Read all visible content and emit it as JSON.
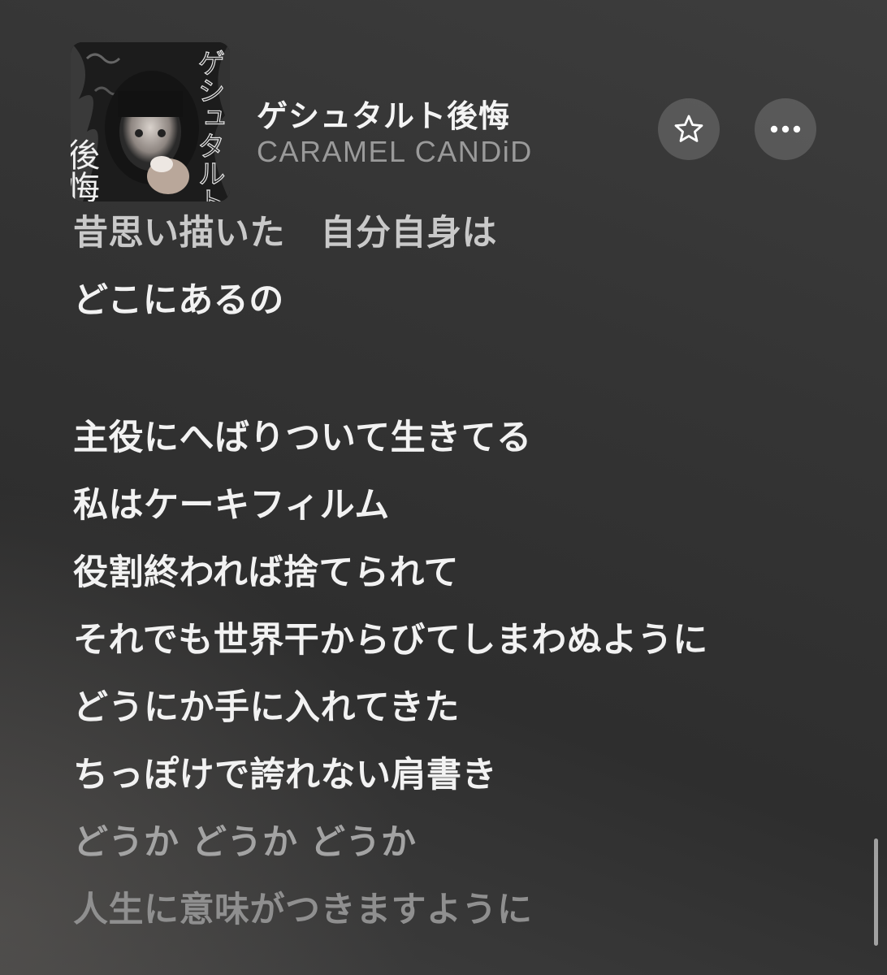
{
  "now_playing": {
    "title": "ゲシュタルト後悔",
    "artist": "CARAMEL CANDiD",
    "artwork": {
      "icon": "album-artwork-icon",
      "art_text_left": "後悔",
      "art_text_right": "ゲシュタルト"
    }
  },
  "controls": {
    "favorite_icon": "star-outline-icon",
    "more_icon": "ellipsis-icon"
  },
  "lyrics": {
    "lines": [
      "昔思い描いた　自分自身は",
      "どこにあるの",
      "",
      "主役にへばりついて生きてる",
      "私はケーキフィルム",
      "役割終われば捨てられて",
      "それでも世界干からびてしまわぬように",
      "どうにか手に入れてきた",
      "ちっぽけで誇れない肩書き",
      "どうか どうか どうか",
      "人生に意味がつきますように"
    ]
  },
  "colors": {
    "text_primary": "#f2f2f2",
    "text_secondary": "#9a9a9a",
    "button_bg": "rgba(255,255,255,0.16)",
    "background": "#353535"
  }
}
